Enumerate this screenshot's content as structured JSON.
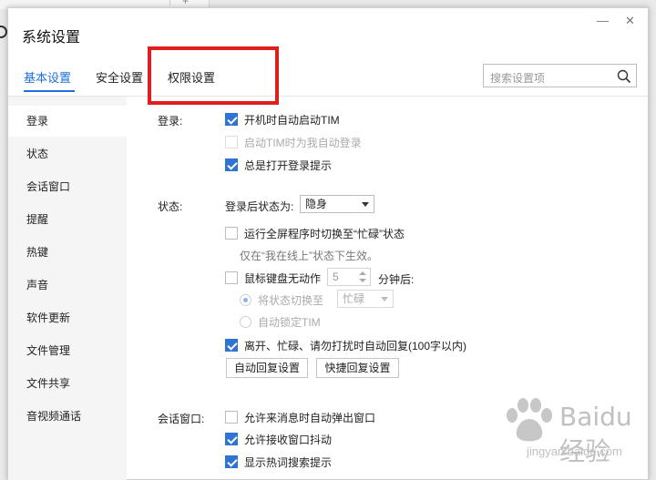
{
  "window": {
    "title": "系统设置",
    "minimize_glyph": "—",
    "close_glyph": "✕"
  },
  "tabs": [
    {
      "label": "基本设置"
    },
    {
      "label": "安全设置"
    },
    {
      "label": "权限设置"
    }
  ],
  "search": {
    "placeholder": "搜索设置项",
    "icon": "search-icon"
  },
  "sidebar": {
    "items": [
      {
        "label": "登录"
      },
      {
        "label": "状态"
      },
      {
        "label": "会话窗口"
      },
      {
        "label": "提醒"
      },
      {
        "label": "热键"
      },
      {
        "label": "声音"
      },
      {
        "label": "软件更新"
      },
      {
        "label": "文件管理"
      },
      {
        "label": "文件共享"
      },
      {
        "label": "音视频通话"
      }
    ]
  },
  "login": {
    "label": "登录:",
    "auto_start": {
      "label": "开机时自动启动TIM",
      "checked": true
    },
    "auto_login": {
      "label": "启动TIM时为我自动登录",
      "checked": false,
      "disabled": true
    },
    "show_prompt": {
      "label": "总是打开登录提示",
      "checked": true
    }
  },
  "status": {
    "label": "状态:",
    "after_login_label": "登录后状态为:",
    "after_login_value": "隐身",
    "fullscreen_busy": {
      "label": "运行全屏程序时切换至“忙碌”状态",
      "checked": false
    },
    "fullscreen_hint": "仅在“我在线上”状态下生效。",
    "idle": {
      "label": "鼠标键盘无动作",
      "checked": false,
      "minutes": "5",
      "suffix": "分钟后:"
    },
    "switch_status": {
      "label": "将状态切换至",
      "value": "忙碌"
    },
    "auto_lock": {
      "label": "自动锁定TIM"
    },
    "auto_reply": {
      "label": "离开、忙碌、请勿打扰时自动回复(100字以内)",
      "checked": true
    },
    "auto_reply_settings_button": "自动回复设置",
    "quick_reply_settings_button": "快捷回复设置"
  },
  "session": {
    "label": "会话窗口:",
    "popup": {
      "label": "允许来消息时自动弹出窗口",
      "checked": false
    },
    "shake": {
      "label": "允许接收窗口抖动",
      "checked": true
    },
    "hot_search": {
      "label": "显示热词搜索提示",
      "checked": true
    }
  },
  "watermark": {
    "brand": "Baidu经验",
    "url": "jingyan.baidu.com"
  },
  "colors": {
    "accent": "#1e6fd9",
    "checkbox": "#2f73d4",
    "highlight_box": "#e01e1e"
  }
}
